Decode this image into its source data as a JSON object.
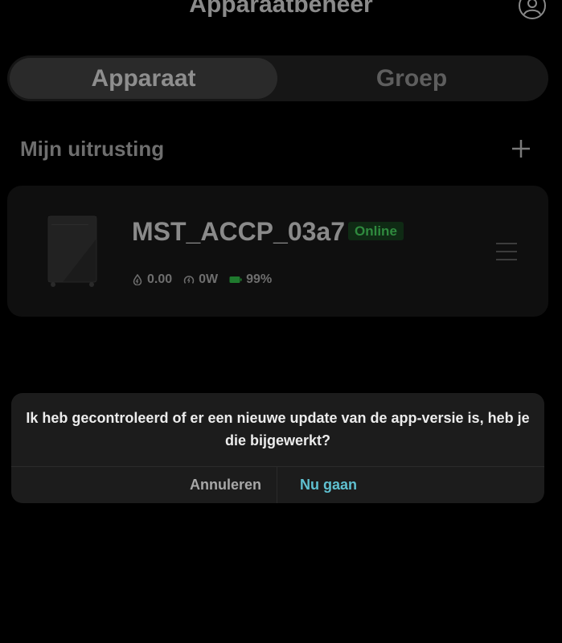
{
  "header": {
    "title": "Apparaatbeheer",
    "profile_icon": "user-circle-icon"
  },
  "segment": {
    "tabs": [
      {
        "label": "Apparaat",
        "active": true
      },
      {
        "label": "Groep",
        "active": false
      }
    ]
  },
  "section": {
    "title": "Mijn uitrusting",
    "add_icon": "plus-icon"
  },
  "device": {
    "name": "MST_ACCP_03a7",
    "status": "Online",
    "status_color": "#2f8a3e",
    "stats": {
      "energy": "0.00",
      "power": "0W",
      "battery": "99%"
    },
    "icons": {
      "image": "device-battery-unit-icon",
      "energy": "energy-drop-icon",
      "power": "power-gauge-icon",
      "battery": "battery-icon",
      "menu": "menu-icon"
    }
  },
  "dialog": {
    "message": "Ik heb gecontroleerd of er een nieuwe update van de app-versie is, heb je die bijgewerkt?",
    "cancel_label": "Annuleren",
    "confirm_label": "Nu gaan",
    "confirm_color": "#5fc0d0"
  }
}
